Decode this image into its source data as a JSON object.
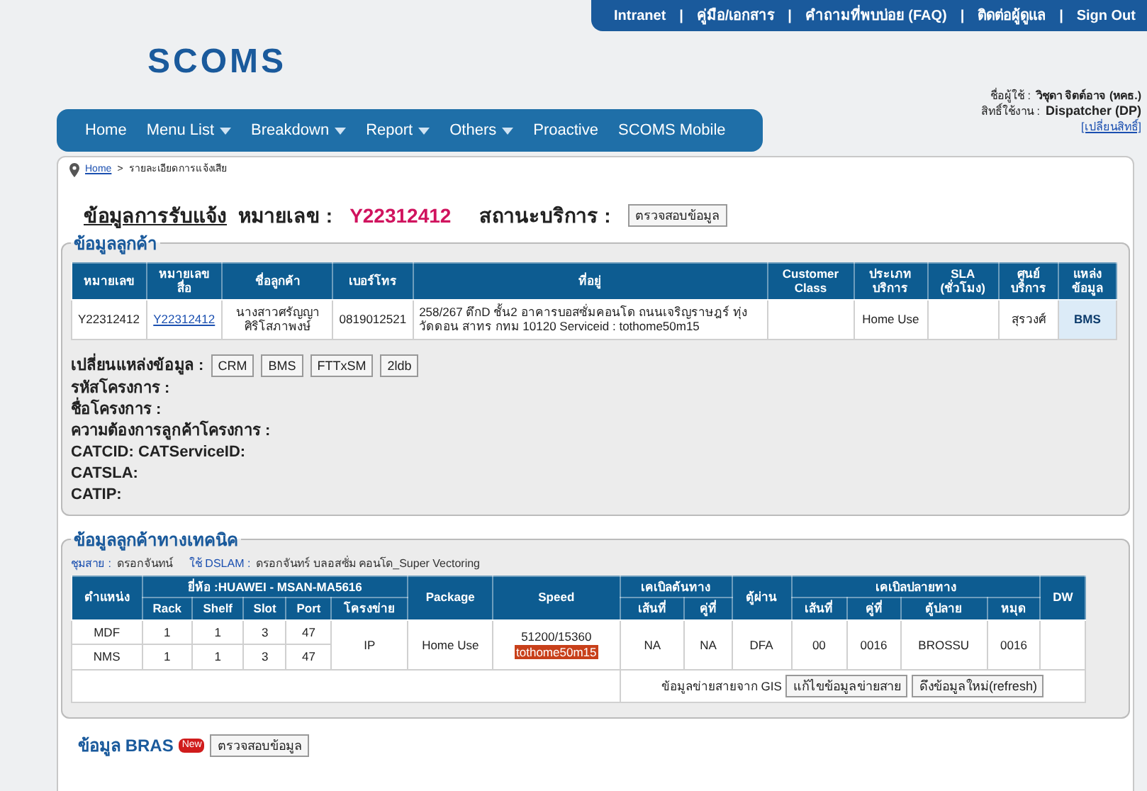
{
  "top_links": [
    "Intranet",
    "คู่มือ/เอกสาร",
    "คำถามที่พบบ่อย (FAQ)",
    "ติดต่อผู้ดูแล",
    "Sign Out"
  ],
  "top_separator": "|",
  "logo": "SCOMS",
  "nav": [
    {
      "label": "Home",
      "dropdown": false
    },
    {
      "label": "Menu List",
      "dropdown": true
    },
    {
      "label": "Breakdown",
      "dropdown": true
    },
    {
      "label": "Report",
      "dropdown": true
    },
    {
      "label": "Others",
      "dropdown": true
    },
    {
      "label": "Proactive",
      "dropdown": false
    },
    {
      "label": "SCOMS Mobile",
      "dropdown": false
    }
  ],
  "user": {
    "name_label": "ชื่อผู้ใช้ :",
    "name": "วิชุดา จิตต์อาจ (หคธ.)",
    "role_label": "สิทธิ์ใช้งาน :",
    "role": "Dispatcher (DP)",
    "change_link": "[เปลี่ยนสิทธิ์]"
  },
  "breadcrumb": {
    "home": "Home",
    "separator": ">",
    "current": "รายละเอียดการแจ้งเสีย"
  },
  "title": {
    "heading": "ข้อมูลการรับแจ้ง",
    "number_label": "หมายเลข :",
    "number": "Y22312412",
    "status_label": "สถานะบริการ :",
    "check_button": "ตรวจสอบข้อมูล"
  },
  "customer": {
    "legend": "ข้อมูลลูกค้า",
    "columns": [
      "หมายเลข",
      "หมายเลขสื่อ",
      "ชื่อลูกค้า",
      "เบอร์โทร",
      "ที่อยู่",
      "Customer Class",
      "ประเภทบริการ",
      "SLA (ชั่วโมง)",
      "ศูนย์บริการ",
      "แหล่งข้อมูล"
    ],
    "row": {
      "number": "Y22312412",
      "media_number": "Y22312412",
      "customer_name": "นางสาวศรัญญา ศิริโสภาพงษ์",
      "phone": "0819012521",
      "address": "258/267 ตึกD ชั้น2 อาคารบอสซั่มคอนโด ถนนเจริญราษฎร์ ทุ่งวัดดอน สาทร กทม 10120 Serviceid : tothome50m15",
      "service_type": "Home Use",
      "service_center": "สุรวงศ์",
      "source": "BMS"
    },
    "source_label": "เปลี่ยนแหล่งข้อมูล :",
    "source_buttons": [
      "CRM",
      "BMS",
      "FTTxSM",
      "2ldb"
    ],
    "fields": [
      "รหัสโครงการ :",
      "ชื่อโครงการ :",
      "ความต้องการลูกค้าโครงการ :",
      "CATCID: CATServiceID:",
      "CATSLA:",
      "CATIP:"
    ]
  },
  "technical": {
    "legend": "ข้อมูลลูกค้าทางเทคนิค",
    "exchange_label": "ชุมสาย :",
    "exchange": "ดรอกจันทน์",
    "dslam_label": "ใช้ DSLAM :",
    "dslam": "ดรอกจันทร์ บลอสซั่ม คอนโด_Super Vectoring",
    "header_top": [
      "ตำแหน่ง",
      "ยี่ห้อ :HUAWEI - MSAN-MA5616",
      "Package",
      "Speed",
      "เคเบิลต้นทาง",
      "ตู้ผ่าน",
      "เคเบิลปลายทาง",
      "DW"
    ],
    "header_sub": [
      "Rack",
      "Shelf",
      "Slot",
      "Port",
      "โครงข่าย",
      "เส้นที่",
      "คู่ที่",
      "เส้นที่",
      "คู่ที่",
      "ตู้ปลาย",
      "หมุด"
    ],
    "rows": [
      {
        "position": "MDF",
        "rack": "1",
        "shelf": "1",
        "slot": "3",
        "port": "47"
      },
      {
        "position": "NMS",
        "rack": "1",
        "shelf": "1",
        "slot": "3",
        "port": "47"
      }
    ],
    "shared": {
      "network": "IP",
      "package": "Home Use",
      "speed": "51200/15360",
      "profile": "tothome50m15",
      "cable_line": "NA",
      "cable_pair": "NA",
      "cabinet": "DFA",
      "end_line": "00",
      "end_pair": "0016",
      "end_cabinet": "BROSSU",
      "pin": "0016"
    },
    "gis_label": "ข้อมูลข่ายสายจาก GIS",
    "gis_buttons": [
      "แก้ไขข้อมูลข่ายสาย",
      "ดึงข้อมูลใหม่(refresh)"
    ]
  },
  "bras": {
    "legend": "ข้อมูล BRAS",
    "badge": "New",
    "button": "ตรวจสอบข้อมูล"
  }
}
